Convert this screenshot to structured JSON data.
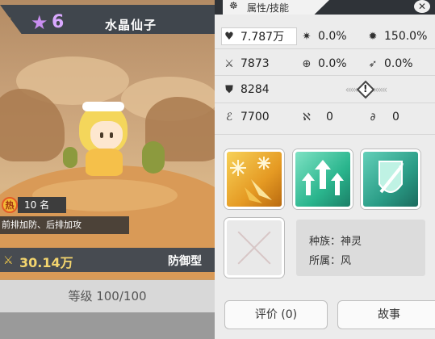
{
  "hero": {
    "star_count": "6",
    "name": "水晶仙子",
    "hot_icon_text": "热",
    "hot_rank": "10 名",
    "role_desc": "前排加防、后排加攻",
    "power": "30.14万",
    "type": "防御型",
    "level": "等级 100/100"
  },
  "panel": {
    "tab_label": "属性/技能",
    "stats": {
      "hp": "7.787万",
      "crit": "0.0%",
      "crit_dmg": "150.0%",
      "atk": "7873",
      "accuracy": "0.0%",
      "dodge": "0.0%",
      "def": "8284",
      "speed": "7700",
      "stat_a": "0",
      "stat_b": "0"
    },
    "warning_mark": "!",
    "info": {
      "race": "种族：神灵",
      "element": "所属：风"
    },
    "buttons": {
      "review": "评价 (0)",
      "story": "故事"
    }
  },
  "icons": {
    "close": "close-icon",
    "star": "star-icon",
    "wing": "wing-icon",
    "power": "swords-icon"
  }
}
